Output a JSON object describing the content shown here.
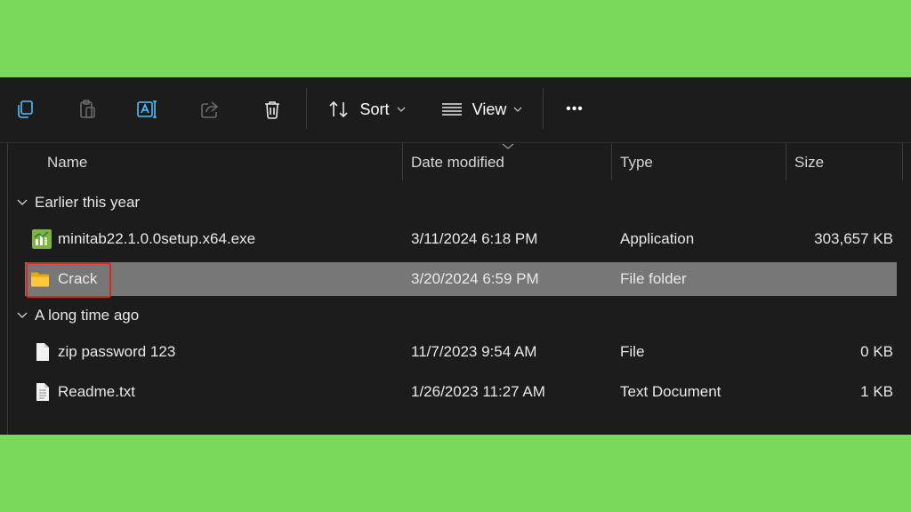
{
  "toolbar": {
    "copy_icon": "copy-icon",
    "paste_icon": "paste-icon",
    "rename_icon": "rename-icon",
    "share_icon": "share-icon",
    "delete_icon": "delete-icon",
    "sort_label": "Sort",
    "view_label": "View",
    "more_label": "•••"
  },
  "columns": {
    "name": "Name",
    "date_modified": "Date modified",
    "type": "Type",
    "size": "Size"
  },
  "groups": [
    {
      "label": "Earlier this year",
      "rows": [
        {
          "name": "minitab22.1.0.0setup.x64.exe",
          "date": "3/11/2024 6:18 PM",
          "type": "Application",
          "size": "303,657 KB",
          "icon": "minitab-app-icon"
        },
        {
          "name": "Crack",
          "date": "3/20/2024 6:59 PM",
          "type": "File folder",
          "size": "",
          "icon": "folder-icon",
          "selected": true
        }
      ]
    },
    {
      "label": "A long time ago",
      "rows": [
        {
          "name": "zip password 123",
          "date": "11/7/2023 9:54 AM",
          "type": "File",
          "size": "0 KB",
          "icon": "file-icon"
        },
        {
          "name": "Readme.txt",
          "date": "1/26/2023 11:27 AM",
          "type": "Text Document",
          "size": "1 KB",
          "icon": "text-file-icon"
        }
      ]
    }
  ],
  "colors": {
    "background": "#7ad85a",
    "window": "#1c1c1c",
    "selection": "#777777",
    "highlight": "#e0261d"
  }
}
